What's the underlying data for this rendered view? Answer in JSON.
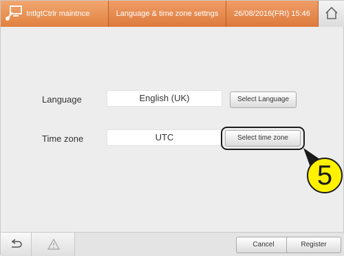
{
  "header": {
    "app_title": "IntlgtCtrlr maintnce",
    "page_title": "Language & time zone settngs",
    "datetime": "26/08/2016(FRI) 15:46",
    "accent_color": "#e38745"
  },
  "settings": {
    "language": {
      "label": "Language",
      "value": "English (UK)",
      "button_label": "Select Language"
    },
    "timezone": {
      "label": "Time zone",
      "value": "UTC",
      "button_label": "Select time zone"
    }
  },
  "annotation": {
    "step_number": "5",
    "badge_color": "#fff100"
  },
  "footer": {
    "back_icon": "back-arrow-icon",
    "warning_icon": "warning-icon",
    "cancel_label": "Cancel",
    "register_label": "Register"
  }
}
